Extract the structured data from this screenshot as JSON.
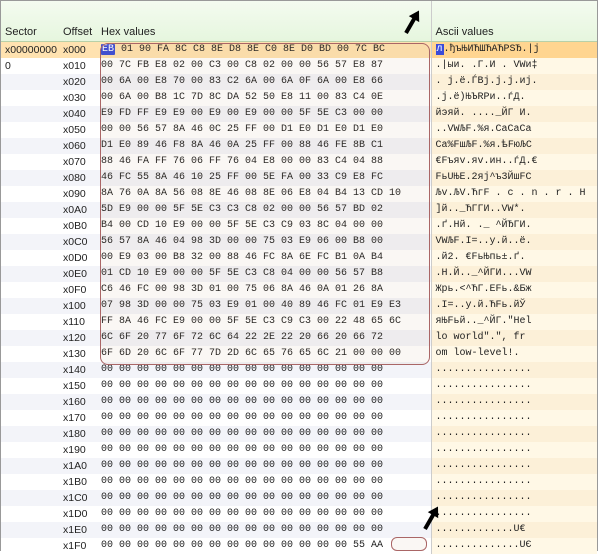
{
  "headers": {
    "sector": "Sector",
    "offset": "Offset",
    "hex": "Hex values",
    "ascii": "Ascii values"
  },
  "rows": [
    {
      "sector": "x00000000",
      "offset": "x000",
      "hex": "EB 01 90 FA 8C C8 8E D8 8E C0 8E D0 BD 00 7C BC",
      "ascii": "л.ђъЊИЋШЋАЋРSЂ.|ј",
      "boot": true
    },
    {
      "sector": "0",
      "offset": "x010",
      "hex": "00 7C FB E8 02 00 C3 00 C8 02 00 00 56 57 E8 87",
      "ascii": ".|ыи. .Г.И . VWи‡"
    },
    {
      "sector": "",
      "offset": "x020",
      "hex": "00 6A 00 E8 70 00 83 C2 6A 00 6A 0F 6A 00 E8 66",
      "ascii": ". j.ё.ЃВj.j.j.иj."
    },
    {
      "sector": "",
      "offset": "x030",
      "hex": "00 6A 00 B8 1C 7D 8C DA 52 50 E8 11 00 83 C4 0E",
      "ascii": ".j.ё)ЊЪRPи..ѓД."
    },
    {
      "sector": "",
      "offset": "x040",
      "hex": "E9 FD FF E9 E9 00 E9 00 E9 00 00 5F 5E C3 00 00",
      "ascii": "йэяй. ...._ЙГ И."
    },
    {
      "sector": "",
      "offset": "x050",
      "hex": "00 00 56 57 8A 46 0C 25 FF 00 D1 E0 D1 E0 D1 E0",
      "ascii": "..VWЉF.%я.СаСаСа"
    },
    {
      "sector": "",
      "offset": "x060",
      "hex": "D1 E0 89 46 F8 8A 46 0A 25 FF 00 88 46 FE 8B C1",
      "ascii": "Са%FшЉF.%я.ᲇFюЉС"
    },
    {
      "sector": "",
      "offset": "x070",
      "hex": "88 46 FA FF 76 06 FF 76 04 E8 00 00 83 C4 04 88",
      "ascii": "€Fъяv.яv.ин..ѓД.€"
    },
    {
      "sector": "",
      "offset": "x080",
      "hex": "46 FC 55 8A 46 10 25 FF 00 5E FA 00 33 C9 E8 FC",
      "ascii": "FьUЊЕ.2яj^ъ3ЙшFC"
    },
    {
      "sector": "",
      "offset": "x090",
      "hex": "8A 76 0A 8A 56 08 8E 46 08 8E 06 E8 04 B4 13 CD 10",
      "ascii": "Љv.ЉV.ЋгF . с . n . r . Н"
    },
    {
      "sector": "",
      "offset": "x0A0",
      "hex": "5D E9 00 00 5F 5E C3 C3 C8 02 00 00 56 57 BD 02",
      "ascii": "]й.._ЋГГИ..VW*."
    },
    {
      "sector": "",
      "offset": "x0B0",
      "hex": "B4 00 CD 10 E9 00 00 5F 5E C3 C9 03 8C 04 00 00",
      "ascii": ".ґ.Нй. ._ ^ЙЂГИ."
    },
    {
      "sector": "",
      "offset": "x0C0",
      "hex": "56 57 8A 46 04 98 3D 00 00 75 03 E9 06 00 B8 00",
      "ascii": "VWЉF.I=..у.й..ё."
    },
    {
      "sector": "",
      "offset": "x0D0",
      "hex": "00 E9 03 00 B8 32 00 88 46 FC 8A 6E FC B1 0A B4",
      "ascii": ".й2. €FьЊпь±.ґ."
    },
    {
      "sector": "",
      "offset": "x0E0",
      "hex": "01 CD 10 E9 00 00 5F 5E C3 C8 04 00 00 56 57 B8",
      "ascii": ".Н.Й.._^ЙГИ...VW"
    },
    {
      "sector": "",
      "offset": "x0F0",
      "hex": "C6 46 FC 00 98 3D 01 00 75 06 8A 46 0A 01 26 8A",
      "ascii": "Жрь.<^ЋГ.ЕFь.&Бж"
    },
    {
      "sector": "",
      "offset": "x100",
      "hex": "07 98 3D 00 00 75 03 E9 01 00 40 89 46 FC 01 E9 E3",
      "ascii": ".I=..у.й.ЋFь.йЎ"
    },
    {
      "sector": "",
      "offset": "x110",
      "hex": "FF 8A 46 FC E9 00 00 5F 5E C3 C9 C3 00 22 48 65 6C",
      "ascii": "яЊFьй.._^ЙГ.\"Hel"
    },
    {
      "sector": "",
      "offset": "x120",
      "hex": "6C 6F 20 77 6F 72 6C 64 22 2E 22 20 66 20 66 72",
      "ascii": "lo world\".\", fr"
    },
    {
      "sector": "",
      "offset": "x130",
      "hex": "6F 6D 20 6C 6F 77 7D 2D 6C 65 76 65 6C 21 00 00 00",
      "ascii": "om low-level!."
    },
    {
      "sector": "",
      "offset": "x140",
      "hex": "00 00 00 00 00 00 00 00 00 00 00 00 00 00 00 00",
      "ascii": "................"
    },
    {
      "sector": "",
      "offset": "x150",
      "hex": "00 00 00 00 00 00 00 00 00 00 00 00 00 00 00 00",
      "ascii": "................"
    },
    {
      "sector": "",
      "offset": "x160",
      "hex": "00 00 00 00 00 00 00 00 00 00 00 00 00 00 00 00",
      "ascii": "................"
    },
    {
      "sector": "",
      "offset": "x170",
      "hex": "00 00 00 00 00 00 00 00 00 00 00 00 00 00 00 00",
      "ascii": "................"
    },
    {
      "sector": "",
      "offset": "x180",
      "hex": "00 00 00 00 00 00 00 00 00 00 00 00 00 00 00 00",
      "ascii": "................"
    },
    {
      "sector": "",
      "offset": "x190",
      "hex": "00 00 00 00 00 00 00 00 00 00 00 00 00 00 00 00",
      "ascii": "................"
    },
    {
      "sector": "",
      "offset": "x1A0",
      "hex": "00 00 00 00 00 00 00 00 00 00 00 00 00 00 00 00",
      "ascii": "................"
    },
    {
      "sector": "",
      "offset": "x1B0",
      "hex": "00 00 00 00 00 00 00 00 00 00 00 00 00 00 00 00",
      "ascii": "................"
    },
    {
      "sector": "",
      "offset": "x1C0",
      "hex": "00 00 00 00 00 00 00 00 00 00 00 00 00 00 00 00",
      "ascii": "................"
    },
    {
      "sector": "",
      "offset": "x1D0",
      "hex": "00 00 00 00 00 00 00 00 00 00 00 00 00 00 00 00",
      "ascii": "................"
    },
    {
      "sector": "",
      "offset": "x1E0",
      "hex": "00 00 00 00 00 00 00 00 00 00 00 00 00 00 00 00",
      "ascii": ".............U€"
    },
    {
      "sector": "",
      "offset": "x1F0",
      "hex": "00 00 00 00 00 00 00 00 00 00 00 00 00 00 55 AA",
      "ascii": "..............UЄ",
      "sig": true
    }
  ],
  "arrow_svg_fill": "#000"
}
